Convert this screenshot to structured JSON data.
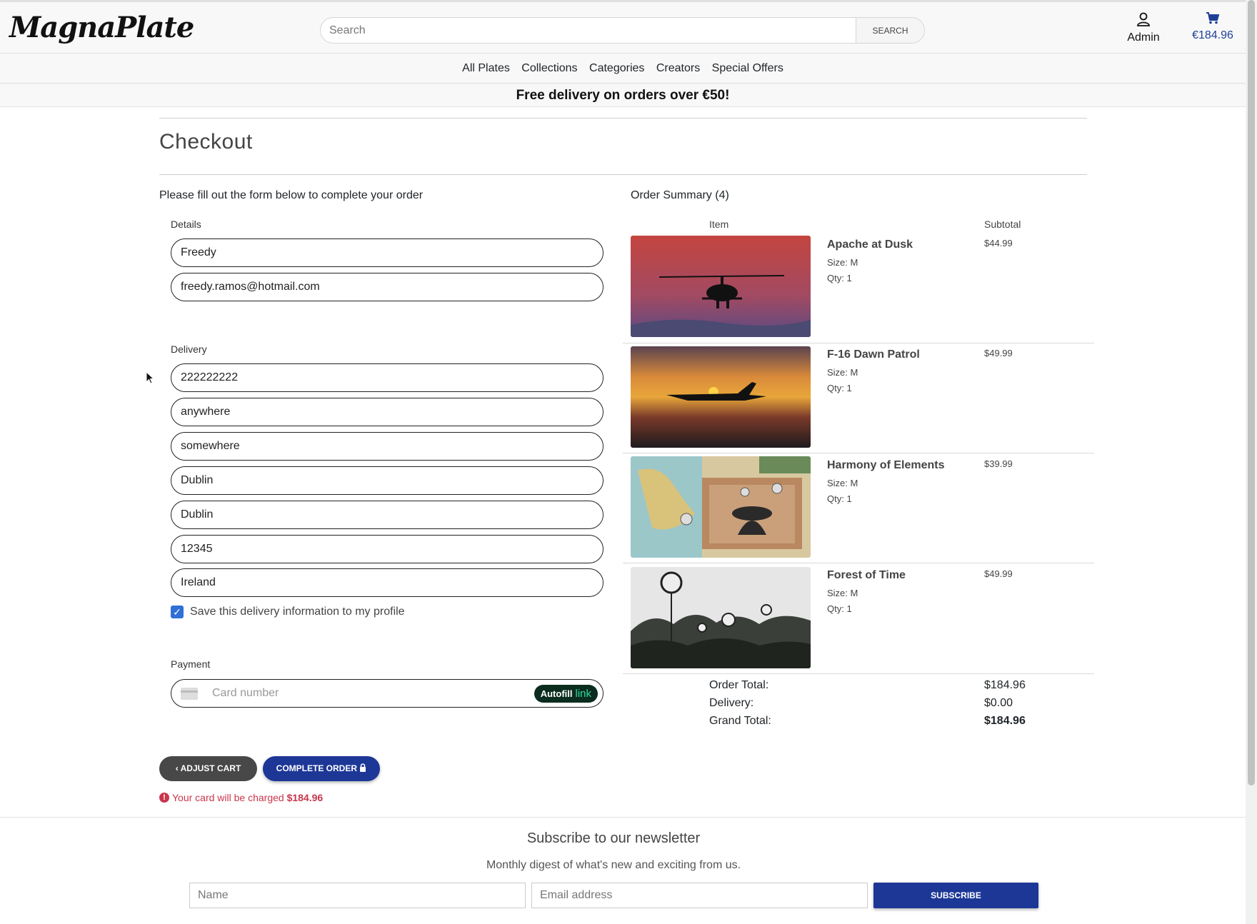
{
  "header": {
    "logo": "MagnaPlate",
    "search_placeholder": "Search",
    "search_button": "SEARCH",
    "admin_label": "Admin",
    "cart_total": "€184.96"
  },
  "nav": [
    "All Plates",
    "Collections",
    "Categories",
    "Creators",
    "Special Offers"
  ],
  "banner": "Free delivery on orders over €50!",
  "page_title": "Checkout",
  "form": {
    "intro": "Please fill out the form below to complete your order",
    "details_label": "Details",
    "name": "Freedy",
    "email": "freedy.ramos@hotmail.com",
    "delivery_label": "Delivery",
    "phone": "222222222",
    "street1": "anywhere",
    "street2": "somewhere",
    "town": "Dublin",
    "county": "Dublin",
    "postcode": "12345",
    "country": "Ireland",
    "save_info_label": "Save this delivery information to my profile",
    "save_info_checked": true,
    "payment_label": "Payment",
    "card_placeholder": "Card number",
    "autofill_label": "Autofill",
    "autofill_link": "link"
  },
  "buttons": {
    "adjust_cart": "ADJUST CART",
    "complete_order": "COMPLETE ORDER"
  },
  "charge_note": {
    "text": "Your card will be charged",
    "amount": "$184.96"
  },
  "summary": {
    "title": "Order Summary (4)",
    "col_item": "Item",
    "col_subtotal": "Subtotal",
    "items": [
      {
        "name": "Apache at Dusk",
        "size": "Size: M",
        "qty": "Qty: 1",
        "subtotal": "$44.99"
      },
      {
        "name": "F-16 Dawn Patrol",
        "size": "Size: M",
        "qty": "Qty: 1",
        "subtotal": "$49.99"
      },
      {
        "name": "Harmony of Elements",
        "size": "Size: M",
        "qty": "Qty: 1",
        "subtotal": "$39.99"
      },
      {
        "name": "Forest of Time",
        "size": "Size: M",
        "qty": "Qty: 1",
        "subtotal": "$49.99"
      }
    ],
    "order_total_label": "Order Total:",
    "order_total": "$184.96",
    "delivery_label": "Delivery:",
    "delivery": "$0.00",
    "grand_total_label": "Grand Total:",
    "grand_total": "$184.96"
  },
  "newsletter": {
    "title": "Subscribe to our newsletter",
    "subtitle": "Monthly digest of what's new and exciting from us.",
    "name_placeholder": "Name",
    "email_placeholder": "Email address",
    "button": "SUBSCRIBE"
  },
  "colors": {
    "brand_blue": "#1d3797",
    "dark_button": "#484848",
    "alert_red": "#c9364c",
    "checkbox_blue": "#2f6fd6"
  }
}
